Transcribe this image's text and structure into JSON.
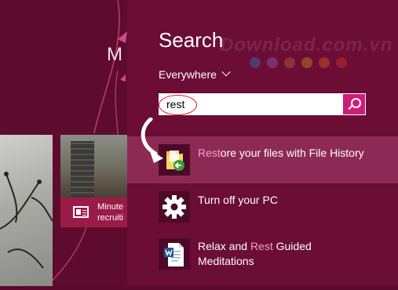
{
  "start": {
    "heading": "M",
    "news_tile_text": "Minute\nrecruiti"
  },
  "charm": {
    "title": "Search",
    "scope": "Everywhere",
    "search_value": "rest",
    "watermark": "Download.com.vn",
    "results": [
      {
        "pre": "",
        "hl": "Rest",
        "post": "ore your files with File History",
        "line2": "",
        "icon": "file-history-icon"
      },
      {
        "pre": "Turn off your PC",
        "hl": "",
        "post": "",
        "line2": "",
        "icon": "gear-icon"
      },
      {
        "pre": "Relax and ",
        "hl": "Rest",
        "post": " Guided",
        "line2": "Meditations",
        "icon": "word-document-icon"
      }
    ]
  },
  "colors": {
    "accent": "#cc1e79",
    "charm_bg": "#6b0d35",
    "selected_bg": "#8c2a55",
    "highlight_text": "#f3a0c3",
    "dots": [
      "#3b5fa8",
      "#8a4f9c",
      "#a8552f",
      "#b07a1b",
      "#c34d28",
      "#c02a2a"
    ]
  }
}
